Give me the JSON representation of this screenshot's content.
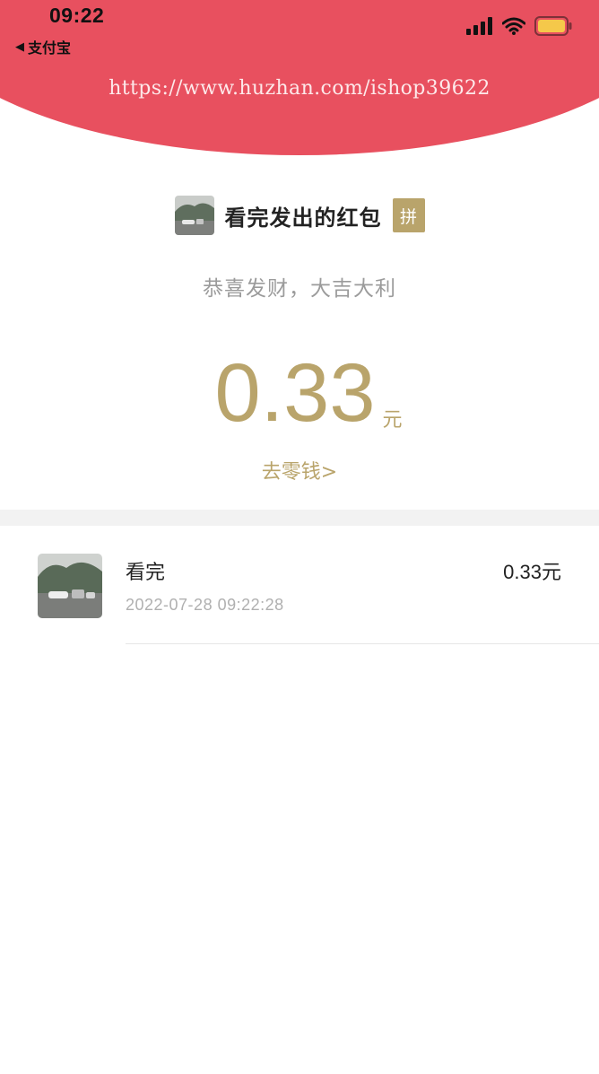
{
  "status_bar": {
    "time": "09:22",
    "back_app": "支付宝"
  },
  "watermark": "https://www.huzhan.com/ishop39622",
  "header": {
    "title": "看完发出的红包",
    "badge": "拼"
  },
  "blessing": "恭喜发财，大吉大利",
  "amount": {
    "value": "0.33",
    "unit": "元"
  },
  "change_link": "去零钱>",
  "records": [
    {
      "name": "看完",
      "time": "2022-07-28 09:22:28",
      "amount": "0.33元"
    }
  ],
  "colors": {
    "header_red": "#e8505f",
    "gold": "#b9a46b",
    "battery": "#f5c84a"
  },
  "icons": [
    "back-caret-icon",
    "signal-icon",
    "wifi-icon",
    "battery-icon",
    "avatar-image"
  ]
}
